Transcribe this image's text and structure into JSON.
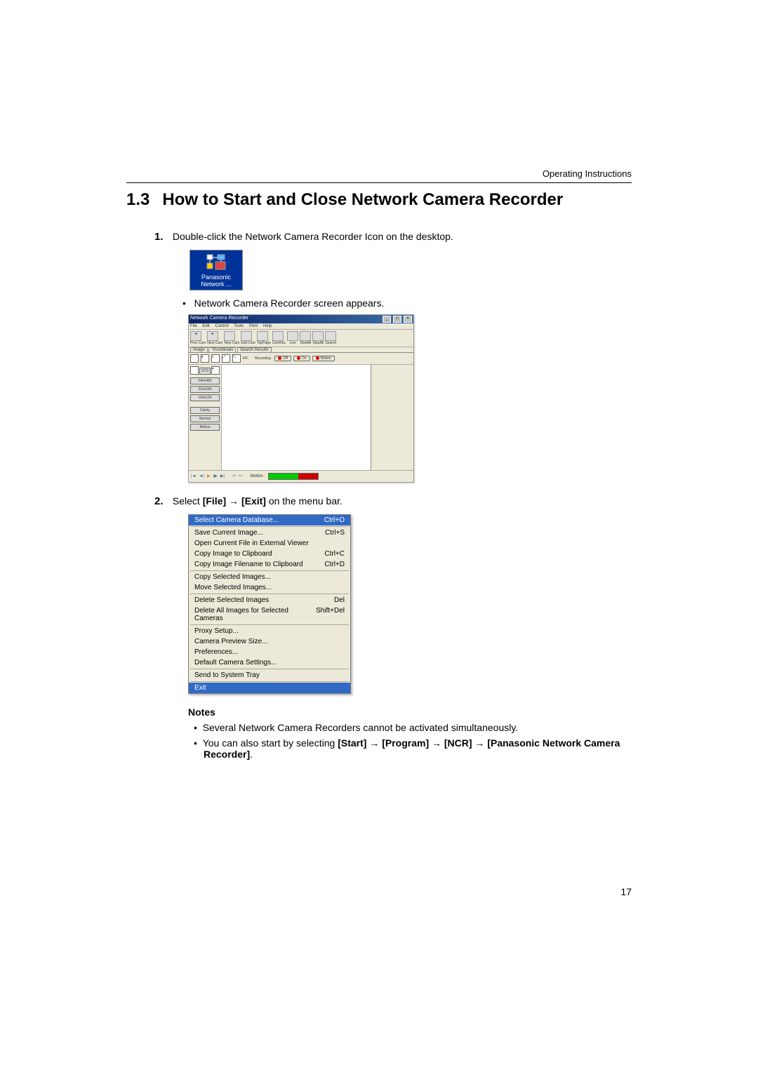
{
  "header": {
    "operating": "Operating Instructions"
  },
  "section": {
    "number": "1.3",
    "title": "How to Start and Close Network Camera Recorder"
  },
  "steps": {
    "s1": {
      "num": "1.",
      "text": "Double-click the Network Camera Recorder Icon on the desktop."
    },
    "bullet1": "Network Camera Recorder screen appears.",
    "s2": {
      "num": "2.",
      "text_pre": "Select ",
      "file": "[File]",
      "arrow": " → ",
      "exit": "[Exit]",
      "text_post": " on the menu bar."
    }
  },
  "desktop_icon": {
    "line1": "Panasonic",
    "line2": "Network ..."
  },
  "app_window": {
    "title": "Network Camera Recorder",
    "menus": [
      "File",
      "Edit",
      "Control",
      "Tools",
      "Print",
      "Help"
    ],
    "toolbar": [
      "Prev Cam",
      "Next Cam",
      "New Cam",
      "Edit Cam",
      "TopPage",
      "CamRec",
      "Live",
      "StartAll",
      "StopAll",
      "Search"
    ],
    "tabs": [
      "Image",
      "Thumbnails",
      "Search Results"
    ],
    "control_row": {
      "fr_label": "FR:",
      "rec_label": "Recording :",
      "btn_off": "Off",
      "btn_on": "On",
      "btn_motion": "Motion"
    },
    "side_buttons": [
      "STD",
      "640x480",
      "320x240",
      "160x120",
      "Clarity",
      "Normal",
      "Motion"
    ],
    "playbar": {
      "motion_label": "Motion :"
    }
  },
  "file_menu": {
    "items": [
      {
        "l": "Select Camera Database...",
        "r": "Ctrl+O",
        "sel": true
      },
      {
        "l": "Save Current Image...",
        "r": "Ctrl+S"
      },
      {
        "l": "Open Current File in External Viewer",
        "r": ""
      },
      {
        "l": "Copy Image to Clipboard",
        "r": "Ctrl+C"
      },
      {
        "l": "Copy Image Filename to Clipboard",
        "r": "Ctrl+D"
      },
      {
        "l": "Copy Selected Images...",
        "r": ""
      },
      {
        "l": "Move Selected Images...",
        "r": ""
      },
      {
        "l": "Delete Selected Images",
        "r": "Del"
      },
      {
        "l": "Delete All Images for Selected Cameras",
        "r": "Shift+Del"
      },
      {
        "l": "Proxy Setup...",
        "r": ""
      },
      {
        "l": "Camera Preview Size...",
        "r": ""
      },
      {
        "l": "Preferences...",
        "r": ""
      },
      {
        "l": "Default Camera Settings...",
        "r": ""
      },
      {
        "l": "Send to System Tray",
        "r": ""
      },
      {
        "l": "Exit",
        "r": "",
        "sel": true
      }
    ],
    "dividers_after": [
      0,
      4,
      6,
      8,
      12,
      13
    ]
  },
  "notes": {
    "heading": "Notes",
    "n1": "Several Network Camera Recorders cannot be activated simultaneously.",
    "n2_pre": "You can also start by selecting ",
    "n2_parts": [
      "[Start]",
      " → ",
      "[Program]",
      " → ",
      "[NCR]",
      " → ",
      "[Panasonic Network Camera Recorder]",
      "."
    ]
  },
  "page_number": "17"
}
